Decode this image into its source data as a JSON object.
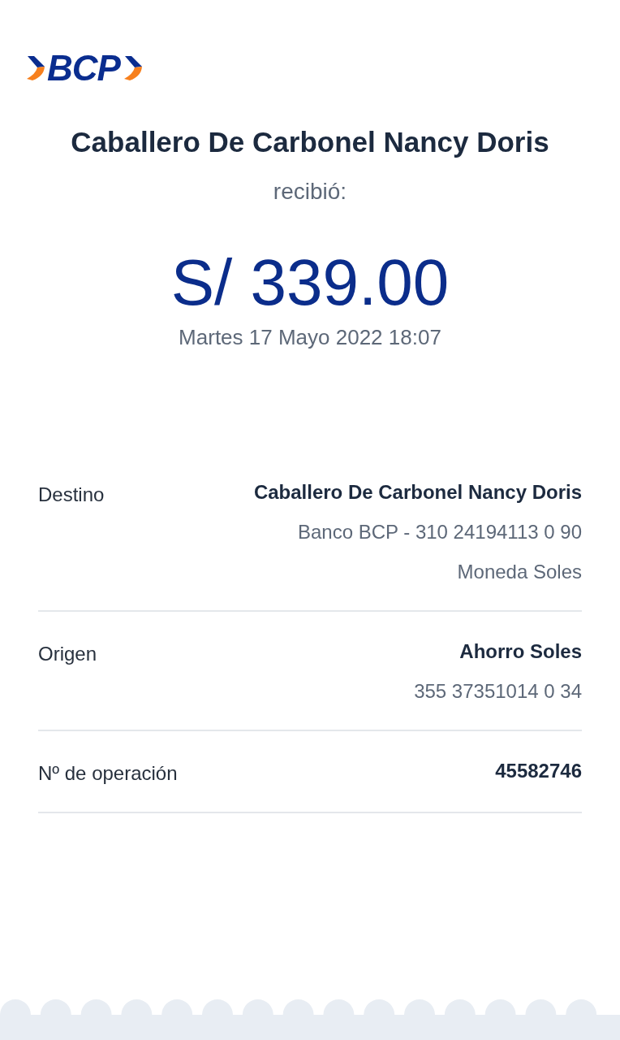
{
  "logo": {
    "text": "BCP"
  },
  "recipient": {
    "name": "Caballero De Carbonel Nancy Doris",
    "caption": "recibió:"
  },
  "amount": "S/ 339.00",
  "date": "Martes 17 Mayo 2022 18:07",
  "details": [
    {
      "label": "Destino",
      "lines": [
        {
          "text": "Caballero De Carbonel Nancy Doris",
          "kind": "primary"
        },
        {
          "text": "Banco BCP - 310 24194113 0 90",
          "kind": "secondary"
        },
        {
          "text": "Moneda Soles",
          "kind": "secondary"
        }
      ]
    },
    {
      "label": "Origen",
      "lines": [
        {
          "text": "Ahorro Soles",
          "kind": "primary"
        },
        {
          "text": "355 37351014 0 34",
          "kind": "secondary"
        }
      ]
    },
    {
      "label": "Nº de operación",
      "lines": [
        {
          "text": "45582746",
          "kind": "primary"
        }
      ]
    }
  ]
}
